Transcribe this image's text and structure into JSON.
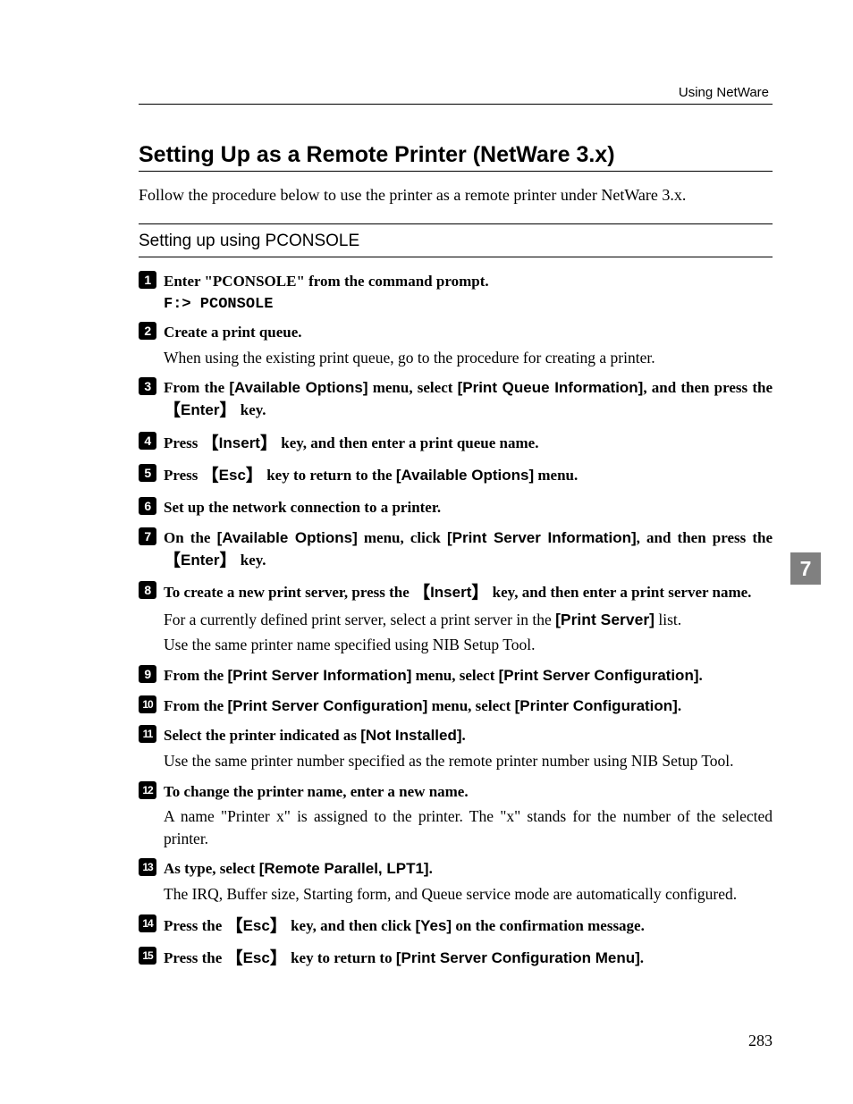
{
  "header": {
    "running": "Using NetWare"
  },
  "title": "Setting Up as a Remote Printer (NetWare 3.x)",
  "intro": "Follow the procedure below to use the printer as a remote printer under NetWare 3.x.",
  "section": "Setting up using PCONSOLE",
  "tab": "7",
  "pageNumber": "283",
  "steps": {
    "s1": {
      "n": "1",
      "head": "Enter \"PCONSOLE\" from the command prompt.",
      "mono": "F:> PCONSOLE"
    },
    "s2": {
      "n": "2",
      "head": "Create a print queue.",
      "body": "When using the existing print queue, go to the procedure for creating a printer."
    },
    "s3": {
      "n": "3",
      "t0": "From the ",
      "u0": "[Available Options]",
      "t1": " menu, select ",
      "u1": "[Print Queue Information]",
      "t2": ", and then press the ",
      "k0": "Enter",
      "t3": " key."
    },
    "s4": {
      "n": "4",
      "t0": "Press ",
      "k0": "Insert",
      "t1": " key, and then enter a print queue name."
    },
    "s5": {
      "n": "5",
      "t0": "Press ",
      "k0": "Esc",
      "t1": " key to return to the ",
      "u0": "[Available Options]",
      "t2": " menu."
    },
    "s6": {
      "n": "6",
      "head": "Set up the network connection to a printer."
    },
    "s7": {
      "n": "7",
      "t0": "On the ",
      "u0": "[Available Options]",
      "t1": " menu, click ",
      "u1": "[Print Server Information]",
      "t2": ", and then press the ",
      "k0": "Enter",
      "t3": " key."
    },
    "s8": {
      "n": "8",
      "t0": "To create a new print server, press the ",
      "k0": "Insert",
      "t1": " key, and then enter a print server name.",
      "b0": "For a currently defined print server, select a print server in the ",
      "bu0": "[Print Server]",
      "b1": " list.",
      "b2": "Use the same printer name specified using NIB Setup Tool."
    },
    "s9": {
      "n": "9",
      "t0": "From the ",
      "u0": "[Print Server Information]",
      "t1": " menu, select ",
      "u1": "[Print Server Configuration]",
      "t2": "."
    },
    "s10": {
      "n": "10",
      "t0": "From the ",
      "u0": "[Print Server Configuration]",
      "t1": " menu, select ",
      "u1": "[Printer Configuration]",
      "t2": "."
    },
    "s11": {
      "n": "11",
      "t0": "Select the printer indicated as ",
      "u0": "[Not Installed]",
      "t1": ".",
      "body": "Use the same printer number specified as the remote printer number using NIB Setup Tool."
    },
    "s12": {
      "n": "12",
      "head": "To change the printer name, enter a new name.",
      "body": "A name \"Printer x\" is assigned to the printer. The \"x\" stands for the number of the selected printer."
    },
    "s13": {
      "n": "13",
      "t0": "As type, select ",
      "u0": "[Remote Parallel, LPT1]",
      "t1": ".",
      "body": "The IRQ, Buffer size, Starting form, and Queue service mode are automatically configured."
    },
    "s14": {
      "n": "14",
      "t0": "Press the ",
      "k0": "Esc",
      "t1": " key, and then click ",
      "u0": "[Yes]",
      "t2": " on the confirmation message."
    },
    "s15": {
      "n": "15",
      "t0": "Press the ",
      "k0": "Esc",
      "t1": " key to return to ",
      "u0": "[Print Server Configuration Menu]",
      "t2": "."
    }
  }
}
